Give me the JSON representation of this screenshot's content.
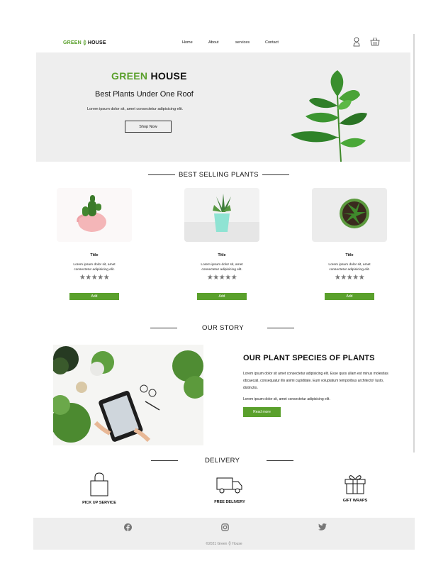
{
  "brand": {
    "green": "GREEN",
    "rest": "HOUSE"
  },
  "nav": {
    "items": [
      "Home",
      "About",
      "services",
      "Contact"
    ]
  },
  "icons": {
    "account": "user-icon",
    "cart": "basket-icon",
    "leaf": "leaf-icon"
  },
  "hero": {
    "title_green": "GREEN",
    "title_rest": " HOUSE",
    "subtitle": "Best Plants Under One Roof",
    "text": "Lorem ipsum dolor sit, amet consectetur adipisicing elit.",
    "button": "Shop Now"
  },
  "best_selling": {
    "heading": "BEST SELLING PLANTS",
    "products": [
      {
        "title": "Title",
        "desc_line1": "Lorem ipsum dolor sit, amet",
        "desc_line2": "consectetur adipisicing elit.",
        "rating": 5,
        "button": "Add"
      },
      {
        "title": "Title",
        "desc_line1": "Lorem ipsum dolor sit, amet",
        "desc_line2": "consectetur adipisicing elit.",
        "rating": 5,
        "button": "Add"
      },
      {
        "title": "Title",
        "desc_line1": "Lorem ipsum dolor sit, amet",
        "desc_line2": "consectetur adipisicing elit.",
        "rating": 5,
        "button": "Add"
      }
    ]
  },
  "story": {
    "heading": "OUR STORY",
    "title": "OUR PLANT SPECIES OF PLANTS",
    "para1": "Lorem ipsum dolor sit amet consectetur adipisicing elit. Esse quos ullam est minus molestias obcaecati, consequatur illo animi cupiditate. Eum voluptatum temporibus architecto! Iusto, distinctio.",
    "para2": "Lorem ipsum dolor sit, amet consectetur adipisicing elit.",
    "button": "Read more"
  },
  "delivery": {
    "heading": "DELIVERY",
    "items": [
      {
        "label": "PICK UP SERVICE",
        "icon": "shopping-bag-icon"
      },
      {
        "label": "FREE DELIVERY",
        "icon": "truck-icon"
      },
      {
        "label": "GIFT WRAPS",
        "icon": "gift-icon"
      }
    ]
  },
  "footer": {
    "social": [
      "facebook-icon",
      "instagram-icon",
      "twitter-icon"
    ],
    "copyright": "©2021 Green",
    "copyright_tail": "House"
  },
  "colors": {
    "accent": "#5aa02c",
    "panel": "#eeeeee",
    "star": "#777777"
  }
}
